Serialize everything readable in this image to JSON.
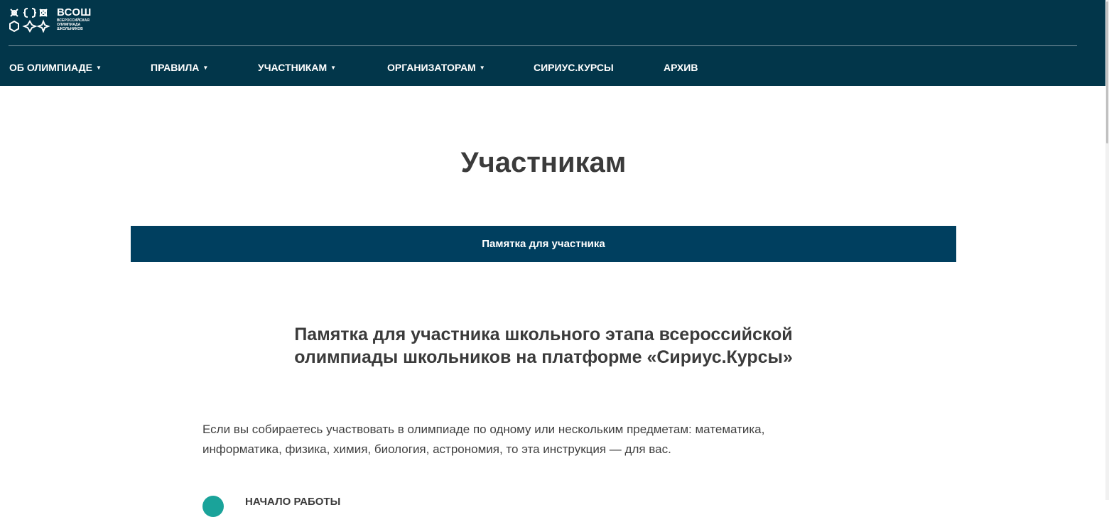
{
  "header": {
    "logo": {
      "title": "ВСОШ",
      "subtitle_lines": [
        "всероссийская",
        "олимпиада",
        "школьников"
      ]
    },
    "nav": [
      {
        "label": "ОБ ОЛИМПИАДЕ",
        "has_dropdown": true
      },
      {
        "label": "ПРАВИЛА",
        "has_dropdown": true
      },
      {
        "label": "УЧАСТНИКАМ",
        "has_dropdown": true
      },
      {
        "label": "ОРГАНИЗАТОРАМ",
        "has_dropdown": true
      },
      {
        "label": "СИРИУС.КУРСЫ",
        "has_dropdown": false
      },
      {
        "label": "АРХИВ",
        "has_dropdown": false
      }
    ]
  },
  "main": {
    "page_title": "Участникам",
    "tab": {
      "label": "Памятка для участника"
    },
    "section_title": "Памятка для участника школьного этапа всероссийской олимпиады школьников на платформе «Сириус.Курсы»",
    "intro": "Если вы собираетесь участвовать в олимпиаде по одному или нескольким предметам: математика, информатика, физика, химия, биология, астрономия, то эта инструкция — для вас.",
    "step": {
      "label": "НАЧАЛО РАБОТЫ"
    }
  },
  "colors": {
    "header_bg": "#02364a",
    "tab_bg": "#003f5f",
    "accent_teal": "#1aa39a",
    "text_dark": "#3b3b3b"
  }
}
